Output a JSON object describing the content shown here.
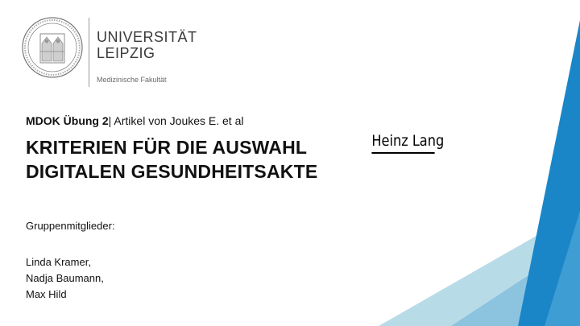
{
  "logo": {
    "university_line1": "UNIVERSITÄT",
    "university_line2": "LEIPZIG",
    "faculty": "Medizinische Fakultät"
  },
  "subtitle": {
    "bold": "MDOK Übung 2",
    "rest": "| Artikel von Joukes E. et al"
  },
  "title": {
    "line1": "KRITERIEN FÜR DIE AUSWAHL",
    "line2": "DIGITALEN GESUNDHEITSAKTE"
  },
  "signature": "Heinz Lang",
  "group": {
    "label": "Gruppenmitglieder:",
    "members": [
      "Linda Kramer,",
      "Nadja Baumann,",
      "Max Hild"
    ]
  },
  "colors": {
    "accent_dark": "#1a86c8",
    "accent_light": "#b8dbe8",
    "accent_mid": "#5eaad6"
  }
}
